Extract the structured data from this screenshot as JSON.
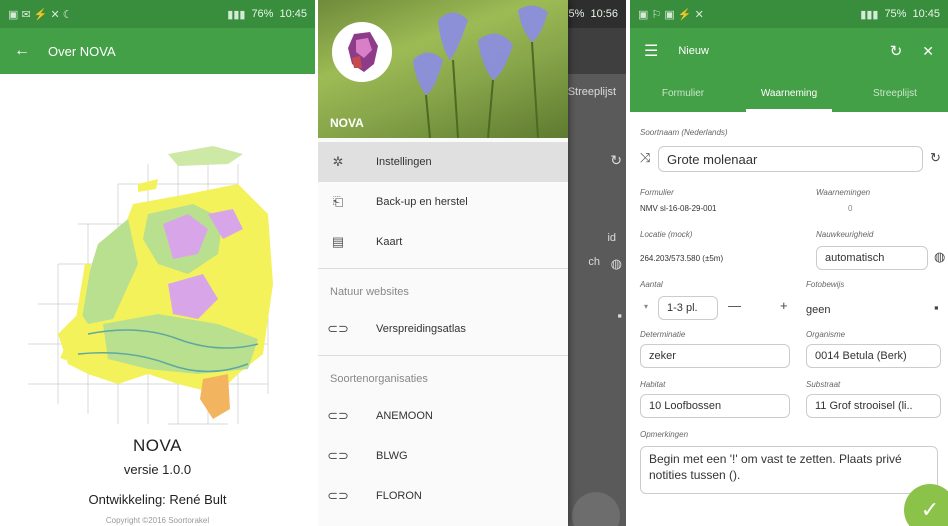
{
  "screen1": {
    "status": {
      "time": "10:45",
      "battery": "76%"
    },
    "appbar": {
      "title": "Over NOVA"
    },
    "about": {
      "name": "NOVA",
      "version": "versie 1.0.0",
      "developer": "Ontwikkeling: René Bult",
      "copyright": "Copyright ©2016 Soortorakel"
    },
    "colors": {
      "bar": "#43a047",
      "map_yellow": "#f4f25a",
      "map_green": "#b8e08f",
      "map_purple": "#d8a6e8",
      "map_orange": "#f3b460"
    }
  },
  "screen2": {
    "status": {
      "time": "10:56",
      "battery": "75%"
    },
    "drawer": {
      "title": "NOVA",
      "items": [
        {
          "label": "Instellingen",
          "icon": "gear-icon"
        },
        {
          "label": "Back-up en herstel",
          "icon": "backup-icon"
        },
        {
          "label": "Kaart",
          "icon": "map-icon"
        }
      ],
      "section1": "Natuur websites",
      "links1": [
        {
          "label": "Verspreidingsatlas",
          "icon": "link-icon"
        }
      ],
      "section2": "Soortenorganisaties",
      "links2": [
        {
          "label": "ANEMOON",
          "icon": "link-icon"
        },
        {
          "label": "BLWG",
          "icon": "link-icon"
        },
        {
          "label": "FLORON",
          "icon": "link-icon"
        }
      ]
    },
    "background": {
      "tab_fragment": "Streeplijst",
      "field_fragment": "ch",
      "label_fragment": "id"
    }
  },
  "screen3": {
    "status": {
      "time": "10:45",
      "battery": "75%"
    },
    "appbar": {
      "title": "Nieuw"
    },
    "tabs": [
      "Formulier",
      "Waarneming",
      "Streeplijst"
    ],
    "form": {
      "species_label": "Soortnaam (Nederlands)",
      "species_value": "Grote molenaar",
      "formulier_label": "Formulier",
      "formulier_value": "NMV sl-16-08-29-001",
      "waarnemingen_label": "Waarnemingen",
      "waarnemingen_value": "0",
      "locatie_label": "Locatie (mock)",
      "locatie_value": "264.203/573.580  (±5m)",
      "nauwkeurigheid_label": "Nauwkeurigheid",
      "nauwkeurigheid_value": "automatisch",
      "aantal_label": "Aantal",
      "aantal_value": "1-3 pl.",
      "fotobewijs_label": "Fotobewijs",
      "fotobewijs_value": "geen",
      "determinatie_label": "Determinatie",
      "determinatie_value": "zeker",
      "organisme_label": "Organisme",
      "organisme_value": "0014 Betula (Berk)",
      "habitat_label": "Habitat",
      "habitat_value": "10 Loofbossen",
      "substraat_label": "Substraat",
      "substraat_value": "11 Grof strooisel (li..",
      "opmerkingen_label": "Opmerkingen",
      "opmerkingen_value": "Begin met een '!' om vast te zetten. Plaats privé notities tussen ()."
    }
  }
}
